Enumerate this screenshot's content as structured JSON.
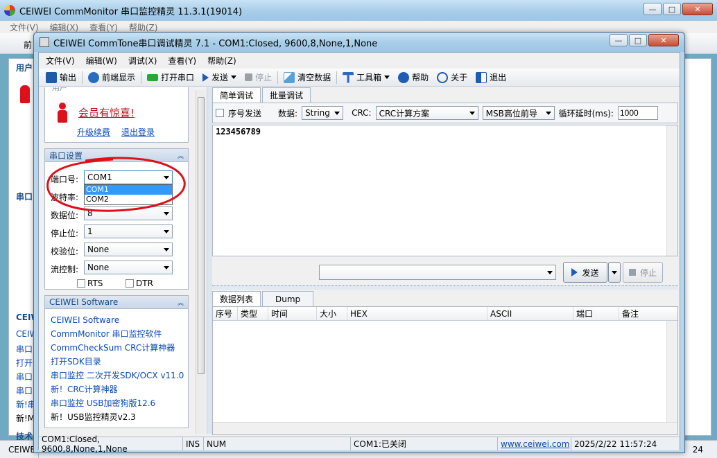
{
  "outer": {
    "title": "CEIWEI CommMonitor 串口监控精灵 11.3.1(19014)",
    "menu": [
      "文件(V)",
      "编辑(X)",
      "查看(Y)",
      "帮助(Z)"
    ],
    "toolbar_first": "前",
    "side_labels": [
      "用户",
      "串口",
      "CEIW",
      "CEIW",
      "串口",
      "打开",
      "串口",
      "串口",
      "新!串",
      "新!M",
      "技术"
    ],
    "status_left": "CEIWE",
    "status_right": "24"
  },
  "window": {
    "title": "CEIWEI CommTone串口调试精灵 7.1 - COM1:Closed, 9600,8,None,1,None",
    "menu": [
      "文件(V)",
      "编辑(W)",
      "调试(X)",
      "查看(Y)",
      "帮助(Z)"
    ],
    "toolbar": [
      {
        "label": "输出",
        "icon": "save-icon",
        "color": "#1d5aa8"
      },
      {
        "label": "前端显示",
        "icon": "pin-icon",
        "color": "#2a6cc2"
      },
      {
        "label": "打开串口",
        "icon": "plug-green-icon",
        "color": "#2aa836"
      },
      {
        "label": "发送",
        "icon": "play-icon",
        "color": "#1e5bb5",
        "dropdown": true
      },
      {
        "label": "停止",
        "icon": "stop-icon",
        "color": "#9aa0a8"
      },
      {
        "label": "清空数据",
        "icon": "clear-icon",
        "color": "#5aa0d8"
      },
      {
        "label": "工具箱",
        "icon": "toolbox-icon",
        "color": "#2a6cc2",
        "dropdown": true
      },
      {
        "label": "帮助",
        "icon": "help-icon",
        "color": "#1e5bb5"
      },
      {
        "label": "关于",
        "icon": "info-icon",
        "color": "#1e5bb5"
      },
      {
        "label": "退出",
        "icon": "exit-icon",
        "color": "#1e5bb5"
      }
    ],
    "user_panel": {
      "header": "用户",
      "vip_text": "会员有惊喜!",
      "upgrade_link": "升级续费",
      "logout_link": "退出登录"
    },
    "port_panel": {
      "header": "串口设置",
      "port_label": "端口号:",
      "port_value": "COM1",
      "port_options": [
        "COM1",
        "COM2"
      ],
      "baud_label": "波特率:",
      "databits_label": "数据位:",
      "databits_value": "8",
      "stopbits_label": "停止位:",
      "stopbits_value": "1",
      "parity_label": "校验位:",
      "parity_value": "None",
      "flow_label": "流控制:",
      "flow_value": "None",
      "rts_label": "RTS",
      "dtr_label": "DTR"
    },
    "links_panel": {
      "header": "CEIWEI Software",
      "items": [
        "CEIWEI Software",
        "CommMonitor 串口监控软件",
        "CommCheckSum CRC计算神器",
        "打开SDK目录",
        "串口监控 二次开发SDK/OCX v11.0",
        "新！CRC计算神器",
        "串口监控 USB加密狗版12.6",
        "新！USB监控精灵v2.3"
      ]
    },
    "tabs_top": [
      "简单调试",
      "批量调试"
    ],
    "send_options": {
      "seq_label": "序号发送",
      "data_label": "数据:",
      "data_value": "String",
      "crc_label": "CRC:",
      "crc_value": "CRC计算方案",
      "order_value": "MSB高位前导",
      "delay_label": "循环延时(ms):",
      "delay_value": "1000"
    },
    "send_text": "123456789",
    "send_button": "发送",
    "stop_button": "停止",
    "tabs_bottom": [
      "数据列表",
      "Dump"
    ],
    "columns": [
      "序号",
      "类型",
      "时间",
      "大小",
      "HEX",
      "ASCII",
      "端口",
      "备注"
    ],
    "status": {
      "port": "COM1:Closed, 9600,8,None,1,None",
      "ins": "INS",
      "num": "NUM",
      "state": "COM1:已关闭",
      "url": "www.ceiwei.com",
      "time": "2025/2/22 11:57:24"
    }
  },
  "colors": {
    "annotation_red": "#e0101a",
    "accent_blue": "#1a4c8a",
    "link": "#0a49b5"
  }
}
